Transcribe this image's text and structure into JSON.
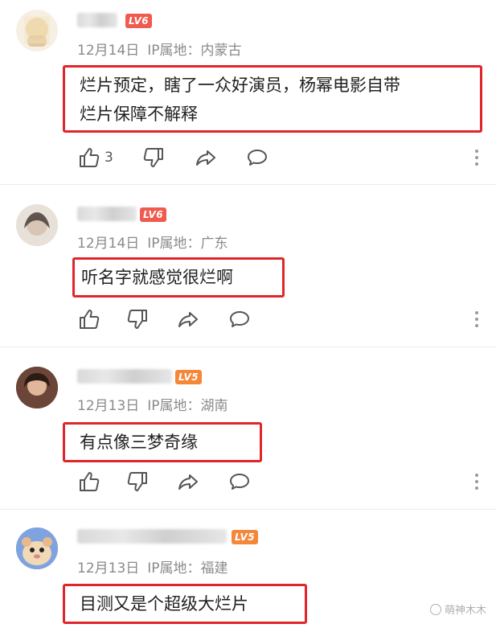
{
  "comments": [
    {
      "level": "LV6",
      "date": "12月14日",
      "ip": "IP属地：内蒙古",
      "text_line1": "烂片预定，瞎了一众好演员，杨幂电影自带",
      "text_line2": "烂片保障不解释",
      "likes": "3"
    },
    {
      "level": "LV6",
      "date": "12月14日",
      "ip": "IP属地：广东",
      "text_line1": "听名字就感觉很烂啊",
      "likes": ""
    },
    {
      "level": "LV5",
      "date": "12月13日",
      "ip": "IP属地：湖南",
      "text_line1": "有点像三梦奇缘",
      "likes": ""
    },
    {
      "level": "LV5",
      "date": "12月13日",
      "ip": "IP属地：福建",
      "text_line1": "目测又是个超级大烂片"
    }
  ],
  "watermark": "萌神木木",
  "colors": {
    "highlight_border": "#e0262a",
    "level6_badge": "#f05a4f",
    "level5_badge": "#f4873a"
  }
}
